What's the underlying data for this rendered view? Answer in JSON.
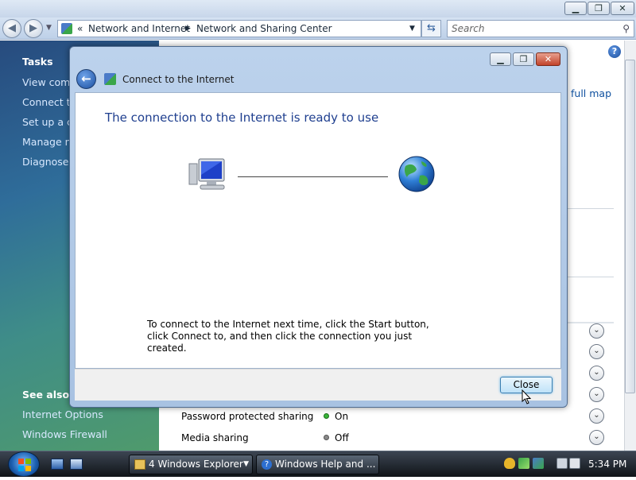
{
  "explorer": {
    "breadcrumb": {
      "prefix": "«",
      "items": [
        "Network and Internet",
        "Network and Sharing Center"
      ]
    },
    "search": {
      "placeholder": "Search"
    },
    "help_label": "?",
    "view_full_map": "full map",
    "sidebar": {
      "tasks_heading": "Tasks",
      "tasks": [
        "View comp",
        "Connect to",
        "Set up a co",
        "Manage ne",
        "Diagnose a"
      ],
      "see_also_heading": "See also",
      "see_also": [
        "Internet Options",
        "Windows Firewall"
      ]
    },
    "sharing_rows": [
      {
        "label": "Password protected sharing",
        "status": "On",
        "status_color": "#3ab53a"
      },
      {
        "label": "Media sharing",
        "status": "Off",
        "status_color": "#8a8a8a"
      }
    ]
  },
  "dialog": {
    "title": "Connect to the Internet",
    "heading": "The connection to the Internet is ready to use",
    "instruction": "To connect to the Internet next time, click the Start button, click Connect to, and then click the connection you just created.",
    "close_label": "Close"
  },
  "taskbar": {
    "buttons": [
      {
        "count": "4",
        "label": "Windows Explorer"
      },
      {
        "label": "Windows Help and ..."
      }
    ],
    "clock": "5:34 PM"
  },
  "colors": {
    "heading_blue": "#1f3f8f",
    "link_blue": "#0d4f9e"
  }
}
